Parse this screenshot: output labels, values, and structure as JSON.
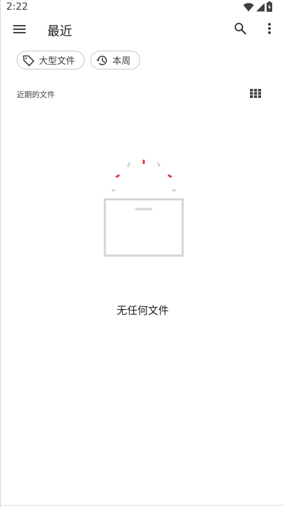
{
  "status_bar": {
    "time": "2:22"
  },
  "app_bar": {
    "title": "最近",
    "menu_icon": "hamburger-menu-icon",
    "search_icon": "search-icon",
    "more_icon": "more-vert-icon"
  },
  "filters": {
    "chips": [
      {
        "label": "大型文件",
        "icon": "tag-icon"
      },
      {
        "label": "本周",
        "icon": "history-icon"
      }
    ]
  },
  "section": {
    "title": "近期的文件",
    "view_icon": "grid-view-icon"
  },
  "empty_state": {
    "message": "无任何文件",
    "accent_color": "#e53935",
    "muted_color": "#d3d3d3"
  }
}
